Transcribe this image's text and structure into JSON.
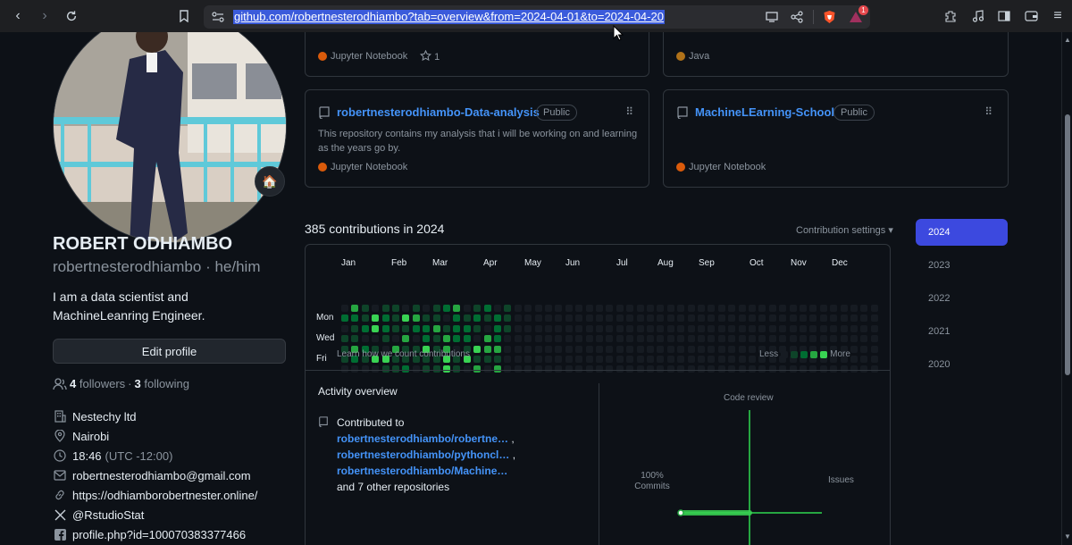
{
  "browser": {
    "url": "github.com/robertnesterodhiambo?tab=overview&from=2024-04-01&to=2024-04-20",
    "shield_badge": "1"
  },
  "profile": {
    "name": "ROBERT ODHIAMBO",
    "username": "robertnesterodhiambo",
    "separator": "·",
    "pronouns": "he/him",
    "bio": "I am a data scientist and MachineLeanring Engineer.",
    "status_emoji": "🏠",
    "edit_button": "Edit profile",
    "followers_count": "4",
    "followers_label": "followers",
    "dot": "·",
    "following_count": "3",
    "following_label": "following",
    "company": "Nestechy ltd",
    "location": "Nairobi",
    "local_time": "18:46",
    "timezone": "(UTC -12:00)",
    "email": "robertnesterodhiambo@gmail.com",
    "website": "https://odhiamborobertnester.online/",
    "twitter": "@RstudioStat",
    "facebook": "profile.php?id=100070383377466"
  },
  "pinned": [
    {
      "name": "",
      "language": "Jupyter Notebook",
      "lang_color": "#DA5B0B",
      "stars": "1",
      "badge": ""
    },
    {
      "name": "",
      "language": "Java",
      "lang_color": "#b07219",
      "badge": ""
    },
    {
      "name": "robertnesterodhiambo-Data-analysis",
      "badge": "Public",
      "description": "This repository contains my analysis that i will be working on and learning as the years go by.",
      "language": "Jupyter Notebook",
      "lang_color": "#DA5B0B"
    },
    {
      "name": "MachineLEarning-School",
      "badge": "Public",
      "description": "",
      "language": "Jupyter Notebook",
      "lang_color": "#DA5B0B"
    }
  ],
  "contributions": {
    "title": "385 contributions in 2024",
    "settings": "Contribution settings ▾",
    "months": [
      "Jan",
      "Feb",
      "Mar",
      "Apr",
      "May",
      "Jun",
      "Jul",
      "Aug",
      "Sep",
      "Oct",
      "Nov",
      "Dec"
    ],
    "days": [
      "Mon",
      "Wed",
      "Fri"
    ],
    "learn": "Learn how we count contributions",
    "less": "Less",
    "more": "More",
    "level_colors": [
      "#161b22",
      "#0e4429",
      "#006d32",
      "#26a641",
      "#39d353"
    ]
  },
  "activity": {
    "title": "Activity overview",
    "contributed_to": "Contributed to",
    "repos": [
      "robertnesterodhiambo/robertne…",
      "robertnesterodhiambo/pythoncl…",
      "robertnesterodhiambo/Machine…"
    ],
    "comma": ",",
    "others": "and 7 other repositories",
    "code_review": "Code review",
    "issues": "Issues",
    "commits_pct": "100%",
    "commits_label": "Commits"
  },
  "years": [
    "2024",
    "2023",
    "2022",
    "2021",
    "2020"
  ]
}
